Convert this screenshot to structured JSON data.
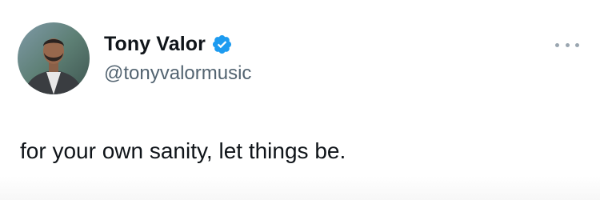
{
  "author": {
    "display_name": "Tony Valor",
    "handle": "@tonyvalormusic",
    "verified": true
  },
  "icons": {
    "verified": "verified-badge-icon",
    "more": "more-options-icon"
  },
  "tweet": {
    "text": "for your own sanity, let things be."
  },
  "colors": {
    "name": "#0f1419",
    "handle": "#536471",
    "verified": "#1d9bf0",
    "more_dots": "#9aa6b0"
  }
}
